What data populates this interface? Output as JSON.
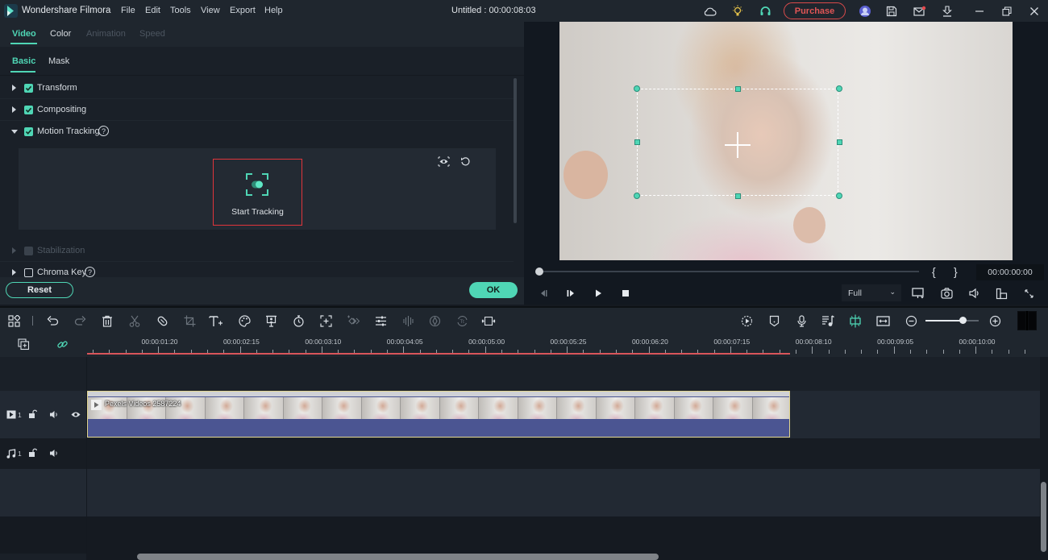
{
  "app": {
    "name": "Wondershare Filmora",
    "document_title": "Untitled : 00:00:08:03",
    "menu": [
      "File",
      "Edit",
      "Tools",
      "View",
      "Export",
      "Help"
    ],
    "purchase_label": "Purchase",
    "accent_color": "#4fd6b5",
    "highlight_color": "#e0353b"
  },
  "title_icons": [
    "cloud-icon",
    "lightbulb-icon",
    "headset-support-icon",
    "avatar-icon",
    "save-icon",
    "mail-icon",
    "download-icon",
    "minimize-icon",
    "restore-icon",
    "close-icon"
  ],
  "left_panel": {
    "tabs": [
      {
        "label": "Video",
        "state": "active"
      },
      {
        "label": "Color",
        "state": "normal"
      },
      {
        "label": "Animation",
        "state": "disabled"
      },
      {
        "label": "Speed",
        "state": "disabled"
      }
    ],
    "subtabs": [
      {
        "label": "Basic",
        "state": "active"
      },
      {
        "label": "Mask",
        "state": "normal"
      }
    ],
    "properties": [
      {
        "label": "Transform",
        "checked": true,
        "expanded": false
      },
      {
        "label": "Compositing",
        "checked": true,
        "expanded": false
      },
      {
        "label": "Motion Tracking",
        "checked": true,
        "expanded": true,
        "help": "?"
      },
      {
        "label": "Stabilization",
        "checked": false,
        "disabled": true
      },
      {
        "label": "Chroma Key",
        "checked": false,
        "help": "?"
      }
    ],
    "motion_tracking": {
      "start_label": "Start Tracking"
    },
    "reset_label": "Reset",
    "ok_label": "OK"
  },
  "preview": {
    "bracket_in": "{",
    "bracket_out": "}",
    "timecode": "00:00:00:00",
    "quality": "Full",
    "scrub_progress": 0.0
  },
  "toolbar": {
    "zoom_level": 0.7
  },
  "timeline": {
    "ruler_labels": [
      "00:00:01:20",
      "00:00:02:15",
      "00:00:03:10",
      "00:00:04:05",
      "00:00:05:00",
      "00:00:05:25",
      "00:00:06:20",
      "00:00:07:15",
      "00:00:08:10",
      "00:00:09:05",
      "00:00:10:00"
    ],
    "tracks": [
      {
        "type": "video",
        "number": "1"
      },
      {
        "type": "audio",
        "number": "1"
      }
    ],
    "clip": {
      "name": "Pexels Videos 2587224"
    }
  }
}
